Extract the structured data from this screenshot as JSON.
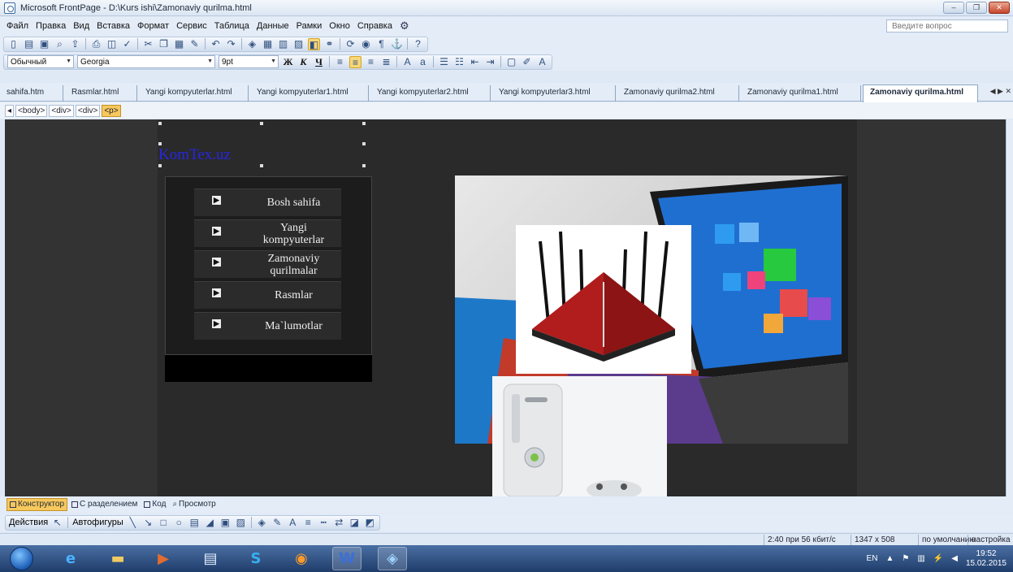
{
  "window": {
    "title": "Microsoft FrontPage - D:\\Kurs ishi\\Zamonaviy qurilma.html",
    "controls": {
      "minimize": "‒",
      "maximize": "❐",
      "close": "✕"
    }
  },
  "menu": {
    "items": [
      "Файл",
      "Правка",
      "Вид",
      "Вставка",
      "Формат",
      "Сервис",
      "Таблица",
      "Данные",
      "Рамки",
      "Окно",
      "Справка"
    ],
    "ask_placeholder": "Введите вопрос"
  },
  "format_toolbar": {
    "style": "Обычный",
    "font": "Georgia",
    "size": "9pt",
    "bold": "Ж",
    "italic": "К",
    "underline": "Ч"
  },
  "doc_tabs": [
    {
      "label": "sahifa.htm",
      "active": false
    },
    {
      "label": "Rasmlar.html",
      "active": false
    },
    {
      "label": "Yangi kompyuterlar.html",
      "active": false
    },
    {
      "label": "Yangi kompyuterlar1.html",
      "active": false
    },
    {
      "label": "Yangi kompyuterlar2.html",
      "active": false
    },
    {
      "label": "Yangi kompyuterlar3.html",
      "active": false
    },
    {
      "label": "Zamonaviy qurilma2.html",
      "active": false
    },
    {
      "label": "Zamonaviy qurilma1.html",
      "active": false
    },
    {
      "label": "Zamonaviy qurilma.html",
      "active": true
    }
  ],
  "tag_selector": [
    "<body>",
    "<div>",
    "<div>",
    "<p>"
  ],
  "page": {
    "site_title": "KomTex.uz",
    "nav": [
      "Bosh sahifa",
      "Yangi kompyuterlar",
      "Zamonaviy qurilmalar",
      "Rasmlar",
      "Ma`lumotlar"
    ]
  },
  "view_tabs": [
    "Конструктор",
    "С разделением",
    "Код",
    "Просмотр"
  ],
  "draw_toolbar": {
    "actions": "Действия",
    "autoshapes": "Автофигуры"
  },
  "status": {
    "speed": "2:40 при 56 кбит/с",
    "size": "1347 x 508",
    "default": "по умолчанию",
    "settings": "настройка"
  },
  "taskbar": {
    "lang": "EN",
    "time": "19:52",
    "date": "15.02.2015"
  },
  "colors": {
    "site_title": "#2626e6",
    "canvas_bg": "#333333",
    "active_view": "#f7c85b"
  }
}
